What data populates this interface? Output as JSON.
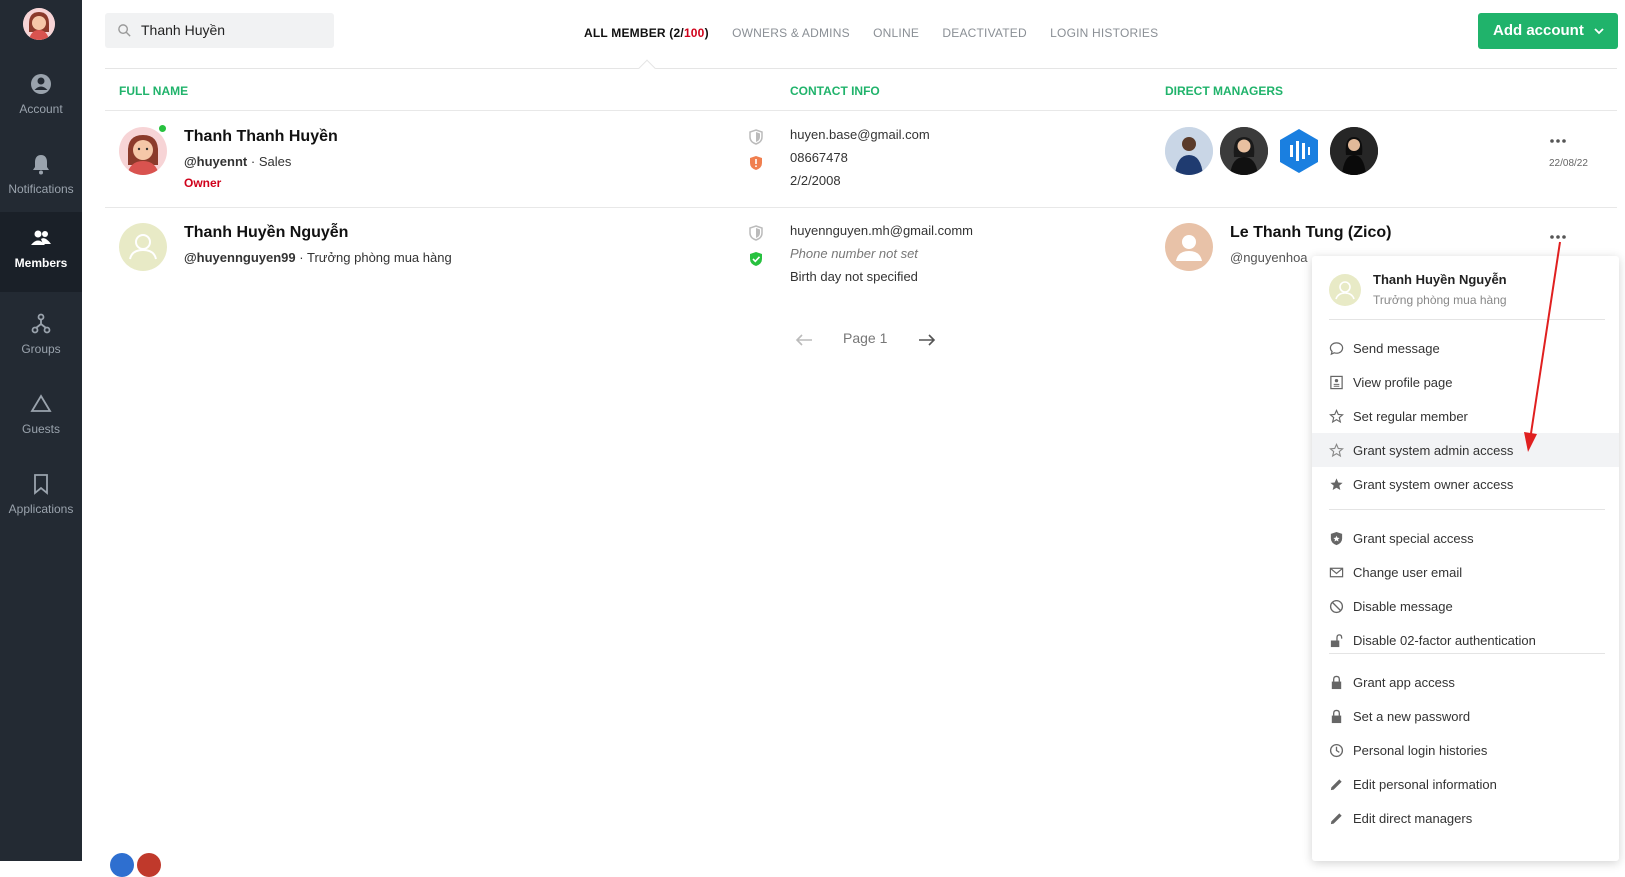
{
  "sidebar": {
    "items": [
      {
        "label": "Account",
        "icon": "account-circle-icon"
      },
      {
        "label": "Notifications",
        "icon": "bell-icon"
      },
      {
        "label": "Members",
        "icon": "members-icon"
      },
      {
        "label": "Groups",
        "icon": "groups-icon"
      },
      {
        "label": "Guests",
        "icon": "triangle-icon"
      },
      {
        "label": "Applications",
        "icon": "bookmark-icon"
      }
    ]
  },
  "search": {
    "value": "Thanh Huyền"
  },
  "tabs": {
    "all_prefix": "ALL MEMBER (",
    "all_count": "2/",
    "all_total": "100",
    "all_suffix": ")",
    "owners": "OWNERS & ADMINS",
    "online": "ONLINE",
    "deactivated": "DEACTIVATED",
    "login": "LOGIN HISTORIES"
  },
  "add_button": {
    "label": "Add account"
  },
  "columns": {
    "name": "FULL NAME",
    "contact": "CONTACT INFO",
    "managers": "DIRECT MANAGERS"
  },
  "rows": [
    {
      "name": "Thanh Thanh Huyền",
      "username": "@huyennt",
      "separator": "·",
      "title": "Sales",
      "role": "Owner",
      "email": "huyen.base@gmail.com",
      "phone": "08667478",
      "birthday": "2/2/2008",
      "date": "22/08/22"
    },
    {
      "name": "Thanh Huyền Nguyễn",
      "username": "@huyennguyen99",
      "separator": "·",
      "title": "Trưởng phòng mua hàng",
      "email": "huyennguyen.mh@gmail.comm",
      "phone": "Phone number not set",
      "birthday": "Birth day not specified",
      "manager_name": "Le Thanh Tung (Zico)",
      "manager_sub": "@nguyenhoa"
    }
  ],
  "pager": {
    "label": "Page 1"
  },
  "menu": {
    "name": "Thanh Huyền Nguyễn",
    "sub": "Trưởng phòng mua hàng",
    "items": [
      {
        "label": "Send message",
        "icon": "chat-bubble-icon"
      },
      {
        "label": "View profile page",
        "icon": "profile-card-icon"
      },
      {
        "label": "Set regular member",
        "icon": "star-outline-icon"
      },
      {
        "label": "Grant system admin access",
        "icon": "star-outline-icon"
      },
      {
        "label": "Grant system owner access",
        "icon": "star-filled-icon"
      },
      {
        "label": "Grant special access",
        "icon": "shield-icon"
      },
      {
        "label": "Change user email",
        "icon": "envelope-icon"
      },
      {
        "label": "Disable message",
        "icon": "block-icon"
      },
      {
        "label": "Disable 02-factor authentication",
        "icon": "unlock-icon"
      },
      {
        "label": "Grant app access",
        "icon": "lock-icon"
      },
      {
        "label": "Set a new password",
        "icon": "lock-icon"
      },
      {
        "label": "Personal login histories",
        "icon": "clock-icon"
      },
      {
        "label": "Edit personal information",
        "icon": "pencil-icon"
      },
      {
        "label": "Edit direct managers",
        "icon": "pencil-icon"
      }
    ]
  },
  "colors": {
    "accent": "#20b36b",
    "sidebar": "#232a33",
    "owner": "#d0021b",
    "annotation": "#e02020"
  }
}
